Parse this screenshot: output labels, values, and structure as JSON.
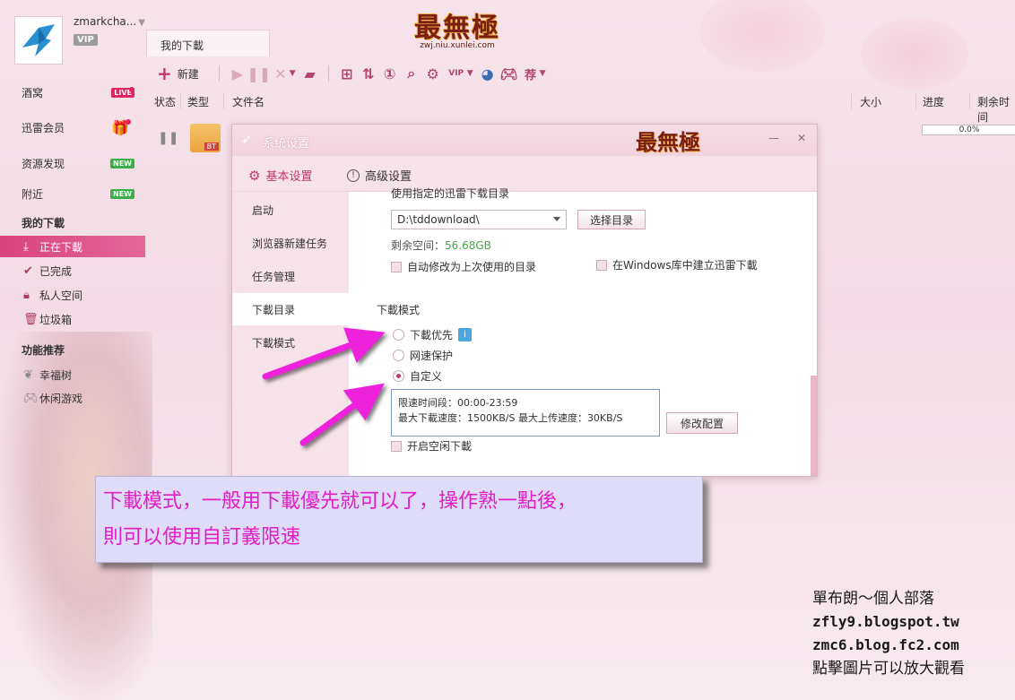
{
  "profile": {
    "username": "zmarkcha...",
    "vip_label": "VIP"
  },
  "sidebar": {
    "items": [
      {
        "label": "酒窝",
        "badge": "LIVE"
      },
      {
        "label": "迅雷会员"
      },
      {
        "label": "资源发现",
        "badge": "NEW"
      },
      {
        "label": "附近",
        "badge": "NEW"
      }
    ],
    "download_section": "我的下載",
    "download_items": [
      {
        "label": "正在下載"
      },
      {
        "label": "已完成"
      },
      {
        "label": "私人空间"
      },
      {
        "label": "垃圾箱"
      }
    ],
    "feature_section": "功能推荐",
    "feature_items": [
      {
        "label": "幸福树"
      },
      {
        "label": "休闲游戏"
      }
    ]
  },
  "header": {
    "logo_text": "最無極",
    "logo_url": "zwj.niu.xunlei.com",
    "tab_label": "我的下載",
    "new_label": "新建",
    "vip_small": "VIP",
    "recommend": "荐"
  },
  "columns": {
    "status": "状态",
    "type": "类型",
    "filename": "文件名",
    "size": "大小",
    "progress": "进度",
    "remaining": "剩余时间"
  },
  "task": {
    "type_badge": "BT",
    "progress": "0.0%"
  },
  "dialog": {
    "title": "系统设置",
    "mini_logo": "最無極",
    "tab_basic": "基本设置",
    "tab_advanced": "高级设置",
    "nav": [
      "启动",
      "浏览器新建任务",
      "任务管理",
      "下載目录",
      "下載模式"
    ],
    "cut_label": "使用指定的迅雷下载目录",
    "dir_value": "D:\\tddownload\\",
    "choose_dir": "选择目录",
    "free_space_label": "剩余空间：",
    "free_space_value": "56.68GB",
    "auto_modify": "自动修改为上次使用的目录",
    "windows_lib": "在Windows库中建立迅雷下載",
    "mode_title": "下載模式",
    "mode_priority": "下載优先",
    "mode_protect": "网速保护",
    "mode_custom": "自定义",
    "limit_period": "限速时间段：00:00-23:59",
    "limit_speeds": "最大下載速度：1500KB/S  最大上传速度：30KB/S",
    "modify_config": "修改配置",
    "idle_download": "开启空闲下載"
  },
  "annotation": {
    "line1": "下載模式，一般用下載優先就可以了，操作熟一點後，",
    "line2": "則可以使用自訂義限速"
  },
  "credits": {
    "line1": "單布朗～個人部落",
    "line2": "zfly9.blogspot.tw",
    "line3": "zmc6.blog.fc2.com",
    "line4": "點擊圖片可以放大觀看"
  },
  "colors": {
    "accent": "#c2376c",
    "annotation_text": "#e21cc7",
    "arrow": "#ee22dd"
  }
}
